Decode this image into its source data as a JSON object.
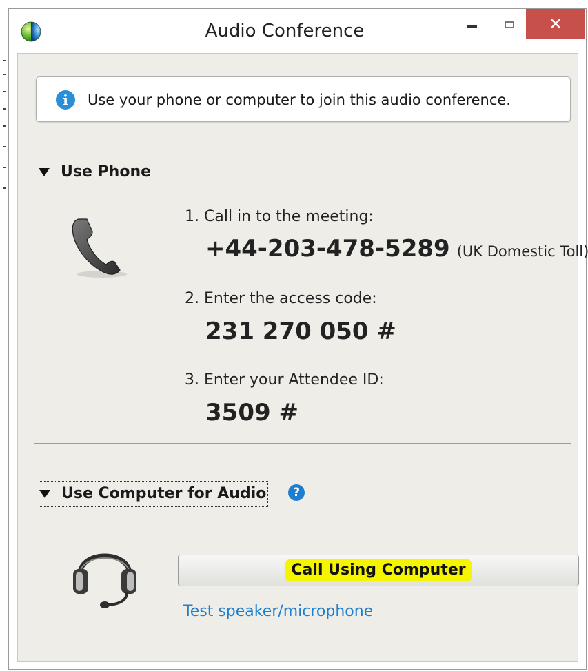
{
  "window": {
    "title": "Audio Conference",
    "controls": {
      "minimize_icon": "minimize-icon",
      "maximize_icon": "maximize-icon",
      "close_glyph": "✕"
    }
  },
  "info": {
    "text": "Use your phone or computer to join this audio conference.",
    "icon_glyph": "i"
  },
  "phone_section": {
    "header": "Use Phone",
    "steps": [
      {
        "label": "1. Call in to the meeting:",
        "value": "+44-203-478-5289",
        "note": "(UK Domestic Toll)"
      },
      {
        "label": "2. Enter the access code:",
        "value": "231 270 050 #"
      },
      {
        "label": "3. Enter your Attendee ID:",
        "value": "3509 #"
      }
    ]
  },
  "computer_section": {
    "header": "Use Computer for Audio",
    "help_glyph": "?",
    "call_button_label": "Call Using Computer",
    "test_link": "Test speaker/microphone"
  },
  "colors": {
    "accent_blue": "#1e7fd0",
    "highlight_yellow": "#f5f500",
    "close_red": "#c7504b",
    "panel_bg": "#eeede7"
  }
}
